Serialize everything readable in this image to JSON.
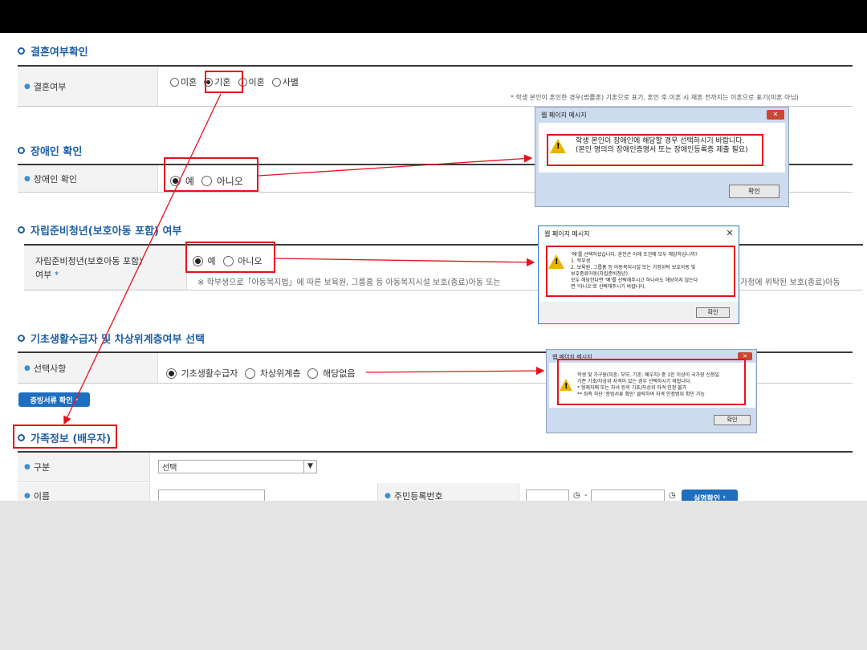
{
  "sections": {
    "marriage": {
      "title": "결혼여부확인",
      "label": "결혼여부",
      "options": [
        "미혼",
        "기혼",
        "이혼",
        "사별"
      ],
      "note": "* 학생 본인이 혼인한 경우(법률혼) 기혼으로 표기, 혼인 후 이혼 시 재혼 전까지는 이혼으로 표기(미혼 아님)"
    },
    "disability": {
      "title": "장애인 확인",
      "label": "장애인 확인",
      "options": [
        "예",
        "아니오"
      ]
    },
    "selfreliance": {
      "title": "자립준비청년(보호아동 포함) 여부",
      "label_line1": "자립준비청년(보호아동 포함)",
      "label_line2": "여부",
      "required_mark": "*",
      "options": [
        "예",
        "아니오"
      ],
      "note_left": "※ 학부생으로「아동복지법」에 따른 보육원, 그룹홈 등 아동복지시설 보호(종료)아동 또는",
      "note_right": "가정에 위탁된 보호(종료)아동"
    },
    "basic_living": {
      "title": "기초생활수급자 및 차상위계층여부 선택",
      "label": "선택사항",
      "options": [
        "기초생활수급자",
        "차상위계층",
        "해당없음"
      ],
      "button": "증빙서류 확인"
    },
    "family": {
      "title": "가족정보 (배우자)",
      "type_label": "구분",
      "type_value": "선택",
      "name_label": "이름",
      "rrn_label": "주민등록번호",
      "rrn_sep": "-",
      "verify_button": "실명확인"
    }
  },
  "dialogs": {
    "d1": {
      "title": "웹 페이지 메시지",
      "lines": [
        "학생 본인이 장애인에 해당할 경우 선택하시기 바랍니다.",
        "(본인 명의의 장애인증명서 또는 장애인등록증 제출 필요)"
      ],
      "ok": "확인"
    },
    "d2": {
      "title": "웹 페이지 메시지",
      "lines": [
        "'예'를 선택하셨습니다. 혼인은 아래 조건에 모두 해당하십니까?",
        "1. 학부생",
        "2. 보육원, 그룹홈 등 아동복지시설 또는 가정위탁 보호아동 및",
        "   보호종료아동(자립준비청년)",
        "모두 해당한다면 '예'를 선택해주시고 하나라도 해당하지 않는다",
        "면 '아니오'로 선택해주시기 바랍니다."
      ],
      "ok": "확인"
    },
    "d3": {
      "title": "웹 페이지 메시지",
      "lines": [
        "학생 및 가구원(미혼: 부모, 기혼: 배우자) 중 1인 이상이 국가장 신청일",
        "기준 기초/차상위 자격이 있는 경우 선택하시기 바랍니다.",
        "* 형제자매 또는 자녀 등의 기초/차상위 자격 인정 불가",
        "** 좌측 하단 '증빙서류 확인' 클릭하여 자격 인정범위 확인 가능"
      ],
      "ok": "확인"
    }
  },
  "colors": {
    "accent": "#1d5fa6",
    "highlight": "#e8101b",
    "button_blue": "#1f6fc1"
  }
}
